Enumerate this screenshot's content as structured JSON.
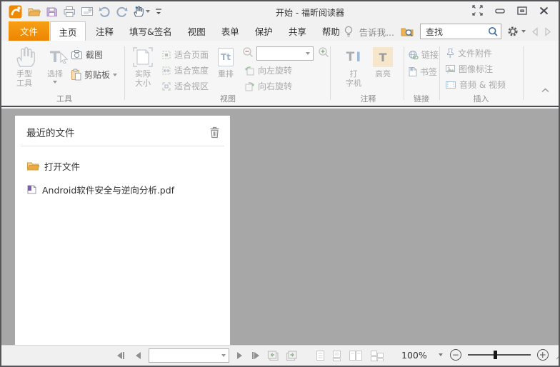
{
  "window": {
    "title": "开始 - 福昕阅读器"
  },
  "quick_access_icons": [
    "foxit-logo",
    "open-folder",
    "save",
    "print",
    "email",
    "undo",
    "redo",
    "hand-tool",
    "customize-toolbar"
  ],
  "window_control_icons": [
    "fullscreen",
    "minimize",
    "restore",
    "close"
  ],
  "tabs": {
    "file": "文件",
    "items": [
      "主页",
      "注释",
      "填写&签名",
      "视图",
      "表单",
      "保护",
      "共享",
      "帮助"
    ]
  },
  "menubar": {
    "tell_me": "告诉我...",
    "search_value": "查找",
    "icons": [
      "lightbulb",
      "search-folder",
      "magnifier",
      "gear",
      "back-chevron",
      "forward-chevron"
    ]
  },
  "ribbon": {
    "tools": {
      "label": "工具",
      "hand1": "手型",
      "hand2": "工具",
      "select": "选择",
      "select_icon_letter": "T",
      "snapshot": "截图",
      "clipboard": "剪贴板"
    },
    "view": {
      "label": "视图",
      "actual1": "实际",
      "actual2": "大小",
      "fit_page": "适合页面",
      "fit_width": "适合宽度",
      "fit_visible": "适合视区",
      "reflow": "重排",
      "reflow_icon_text": "Tt",
      "rotate_left": "向左旋转",
      "rotate_right": "向右旋转"
    },
    "comment": {
      "label": "注释",
      "tw1": "打",
      "tw2": "字机",
      "tw_icon_t": "T",
      "tw_icon_i": "I",
      "highlight": "高亮",
      "highlight_icon_letter": "T"
    },
    "links": {
      "label": "链接",
      "link": "链接",
      "bookmark": "书签"
    },
    "insert": {
      "label": "插入",
      "attachment": "文件附件",
      "image": "图像标注",
      "audio_video": "音频 & 视频"
    }
  },
  "recent": {
    "title": "最近的文件",
    "open_file": "打开文件",
    "files": [
      "Android软件安全与逆向分析.pdf"
    ]
  },
  "statusbar": {
    "zoom_level": "100%",
    "icons": [
      "first-page",
      "prev-page",
      "page-number-box",
      "next-page",
      "last-page",
      "previous-view",
      "next-view",
      "single-page",
      "continuous",
      "facing",
      "continuous-facing",
      "zoom-out",
      "zoom-slider",
      "zoom-in",
      "resize-grip"
    ]
  },
  "colors": {
    "accent_orange": "#ef8a00",
    "doc_background": "#a7a7a7",
    "highlight_beige": "#f6e6cb",
    "pdf_purple": "#7b5fa8",
    "search_magnifier_blue": "#3a6ea5"
  }
}
